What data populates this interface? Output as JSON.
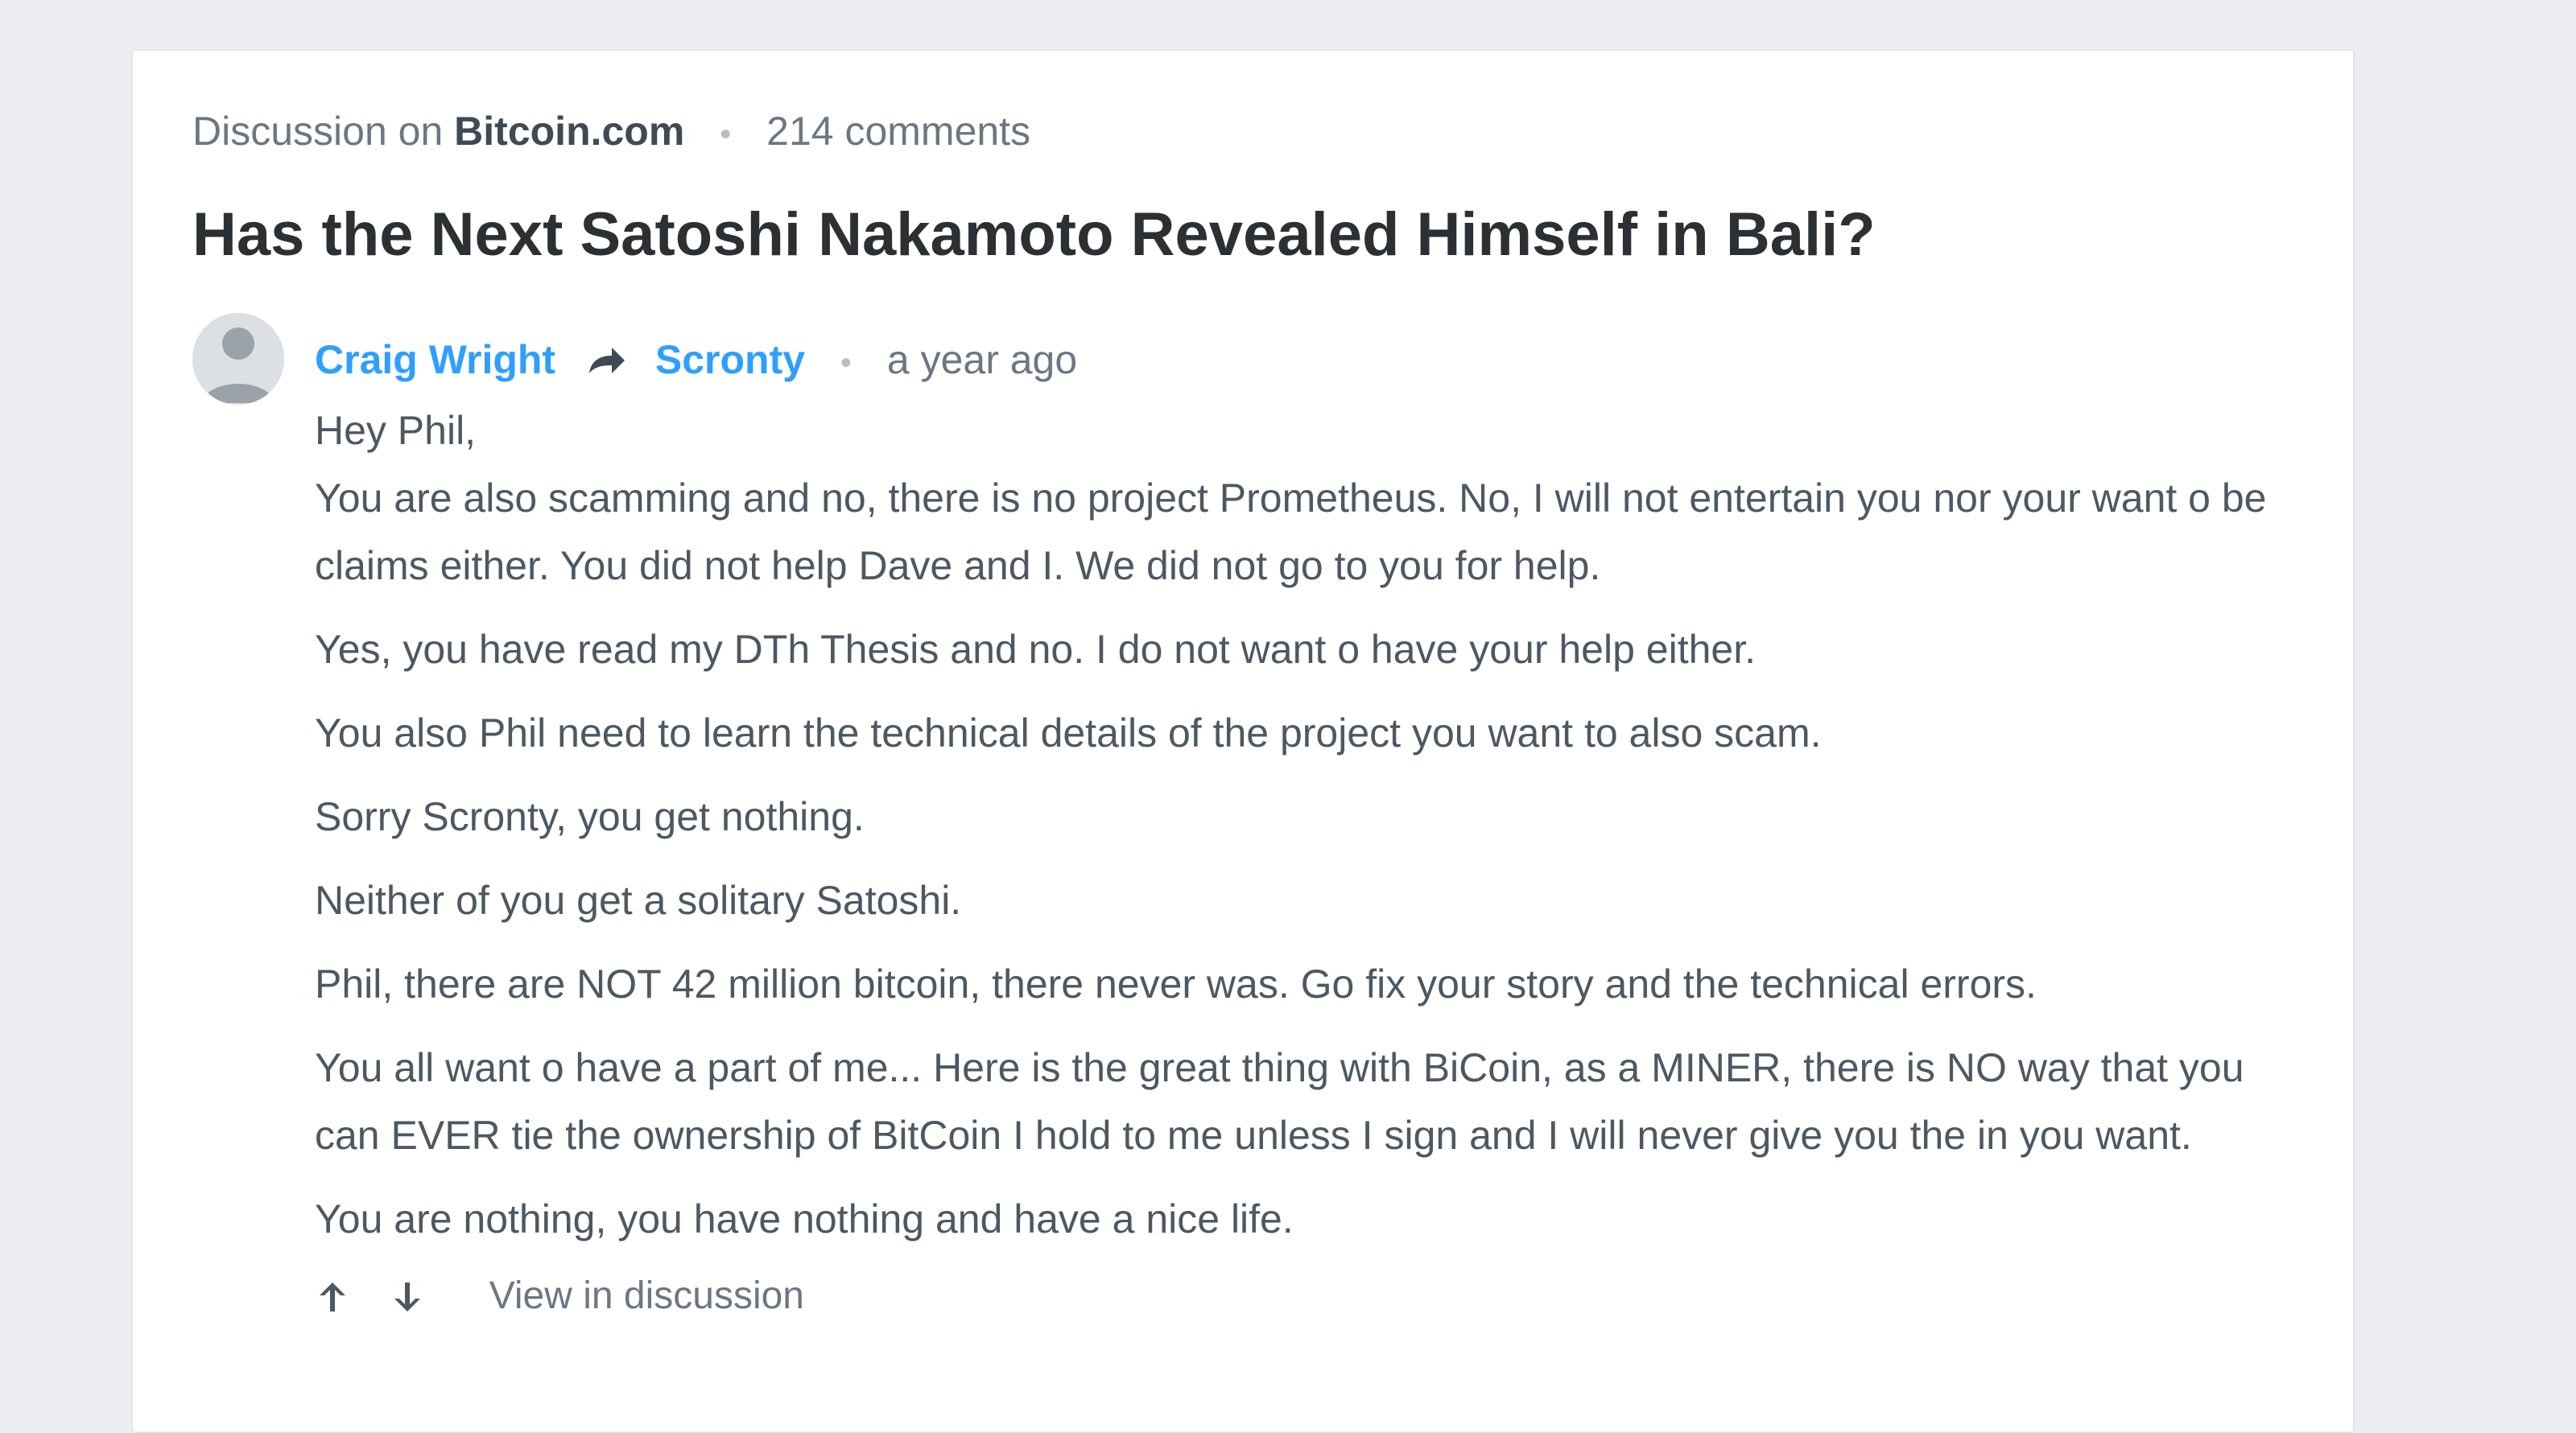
{
  "header": {
    "prefix": "Discussion on",
    "site": "Bitcoin.com",
    "comment_count": "214 comments"
  },
  "article": {
    "title": "Has the Next Satoshi Nakamoto Revealed Himself in Bali?"
  },
  "comment": {
    "author": "Craig Wright",
    "reply_to": "Scronty",
    "time": "a year ago",
    "paragraphs": [
      "Hey Phil,",
      "You are also scamming and no, there is no project Prometheus. No, I will not entertain you nor your want o be claims either. You did not help Dave and I. We did not go to you for help.",
      "Yes, you have read my DTh Thesis and no. I do not want o have your help either.",
      "You also Phil need to learn the technical details of the project you want to also scam.",
      "Sorry Scronty, you get nothing.",
      "Neither of you get a solitary Satoshi.",
      "Phil, there are NOT 42 million bitcoin, there never was. Go fix your story and the technical errors.",
      "You all want o have a part of me... Here is the great thing with BiCoin, as a MINER, there is NO way that you can EVER tie the ownership of BitCoin I hold to me unless I sign and I will never give you the in you want.",
      "You are nothing, you have nothing and have a nice life."
    ],
    "actions": {
      "upvote_icon": "arrow-up-icon",
      "downvote_icon": "arrow-down-icon",
      "view_label": "View in discussion"
    }
  },
  "colors": {
    "background": "#eceef1",
    "card": "#ffffff",
    "link": "#2e9fff",
    "title": "#2b3034",
    "muted": "#6b7782"
  }
}
